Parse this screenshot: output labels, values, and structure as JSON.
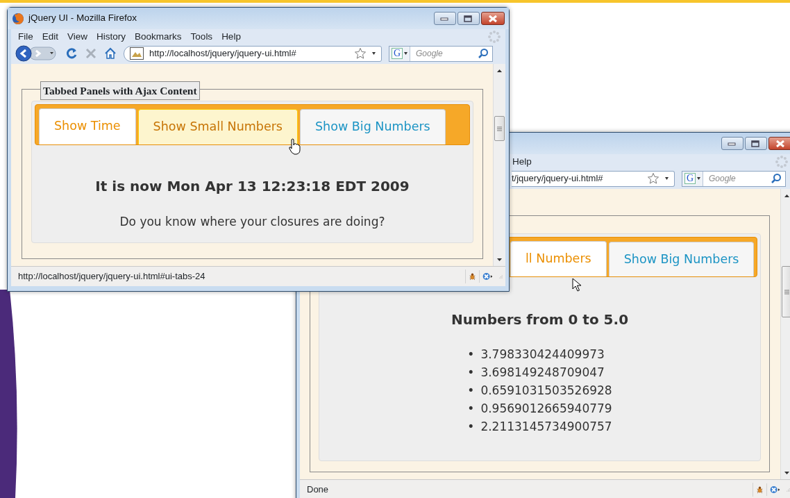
{
  "front_window": {
    "title": "jQuery UI - Mozilla Firefox",
    "menu": [
      "File",
      "Edit",
      "View",
      "History",
      "Bookmarks",
      "Tools",
      "Help"
    ],
    "address": {
      "value": "http://localhost/jquery/jquery-ui.html#"
    },
    "search": {
      "logo": "G",
      "placeholder": "Google"
    },
    "page": {
      "legend": "Tabbed Panels with Ajax Content",
      "tabs": [
        {
          "label": "Show Time",
          "selected": true,
          "hovered": false
        },
        {
          "label": "Show Small Numbers",
          "selected": false,
          "hovered": true
        },
        {
          "label": "Show Big Numbers",
          "selected": false,
          "hovered": false
        }
      ],
      "panel": {
        "heading": "It is now Mon Apr 13 12:23:18 EDT 2009",
        "text": "Do you know where your closures are doing?"
      }
    },
    "status_bar": "http://localhost/jquery/jquery-ui.html#ui-tabs-24"
  },
  "back_window": {
    "menu": [
      "Help"
    ],
    "address": {
      "value": "t/jquery/jquery-ui.html#"
    },
    "search": {
      "logo": "G",
      "placeholder": "Google"
    },
    "page": {
      "tabs": [
        {
          "label": "ll Numbers",
          "selected": true,
          "hovered": false
        },
        {
          "label": "Show Big Numbers",
          "selected": false,
          "hovered": false
        }
      ],
      "panel": {
        "heading": "Numbers from 0 to 5.0",
        "marker": "•",
        "items": [
          "3.798330424409973",
          "3.698149248709047",
          "0.6591031503526928",
          "0.9569012665940779",
          "2.2113145734900757"
        ]
      }
    },
    "status_bar": "Done"
  }
}
